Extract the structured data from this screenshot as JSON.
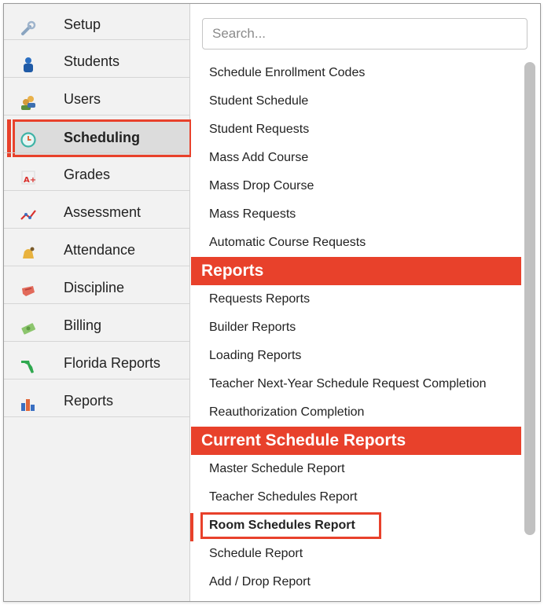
{
  "sidebar": {
    "items": [
      {
        "label": "Setup",
        "icon": "wrench-icon"
      },
      {
        "label": "Students",
        "icon": "student-icon"
      },
      {
        "label": "Users",
        "icon": "users-icon"
      },
      {
        "label": "Scheduling",
        "icon": "clock-icon",
        "active": true
      },
      {
        "label": "Grades",
        "icon": "grades-icon"
      },
      {
        "label": "Assessment",
        "icon": "assessment-icon"
      },
      {
        "label": "Attendance",
        "icon": "bell-icon"
      },
      {
        "label": "Discipline",
        "icon": "discipline-icon"
      },
      {
        "label": "Billing",
        "icon": "money-icon"
      },
      {
        "label": "Florida Reports",
        "icon": "florida-icon"
      },
      {
        "label": "Reports",
        "icon": "bar-chart-icon"
      }
    ]
  },
  "search": {
    "placeholder": "Search..."
  },
  "menu": {
    "scheduling_items": [
      "Schedule Enrollment Codes",
      "Student Schedule",
      "Student Requests",
      "Mass Add Course",
      "Mass Drop Course",
      "Mass Requests",
      "Automatic Course Requests"
    ],
    "reports_header": "Reports",
    "reports_items": [
      "Requests Reports",
      "Builder Reports",
      "Loading Reports",
      "Teacher Next-Year Schedule Request Completion",
      "Reauthorization Completion"
    ],
    "current_header": "Current Schedule Reports",
    "current_items": [
      "Master Schedule Report",
      "Teacher Schedules Report",
      "Room Schedules Report",
      "Schedule Report",
      "Add / Drop Report"
    ]
  },
  "colors": {
    "accent": "#e8412b",
    "sidebar_bg": "#f2f2f2"
  }
}
